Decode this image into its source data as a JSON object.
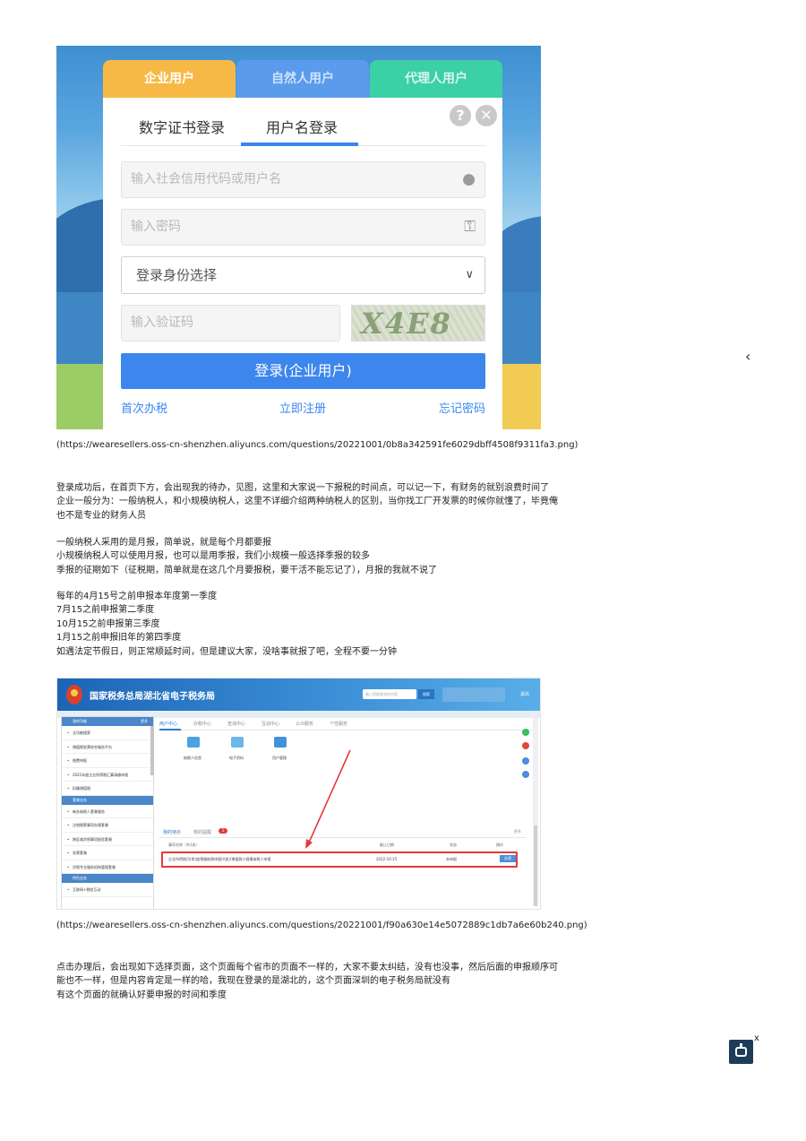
{
  "login": {
    "user_tabs": [
      "企业用户",
      "自然人用户",
      "代理人用户"
    ],
    "method_tabs": [
      "数字证书登录",
      "用户名登录"
    ],
    "help_icon": "?",
    "close_icon": "✕",
    "username_placeholder": "输入社会信用代码或用户名",
    "password_placeholder": "输入密码",
    "role_select": "登录身份选择",
    "captcha_placeholder": "输入验证码",
    "captcha_text": "X4E8",
    "login_button": "登录(企业用户)",
    "links": [
      "首次办税",
      "立即注册",
      "忘记密码"
    ]
  },
  "url1": "(https://weareseIlers.oss-cn-shenzhen.aliyuncs.com/questions/20221001/0b8a342591fe6029dbff4508f9311fa3.png)",
  "para1": [
    "登录成功后，在首页下方，会出现我的待办，见图，这里和大家说一下报税的时间点，可以记一下，有财务的就别浪费时间了",
    "企业一般分为：一般纳税人，和小规模纳税人，这里不详细介绍两种纳税人的区别，当你找工厂开发票的时候你就懂了，毕竟俺",
    "也不是专业的财务人员"
  ],
  "para2": [
    "一般纳税人采用的是月报，简单说，就是每个月都要报",
    "小规模纳税人可以使用月报，也可以是用季报，我们小规模一般选择季报的较多",
    "季报的征期如下（征税期，简单就是在这几个月要报税，要干活不能忘记了），月报的我就不说了"
  ],
  "para3": [
    "每年的4月15号之前申报本年度第一季度",
    "7月15之前申报第二季度",
    "10月15之前申报第三季度",
    "1月15之前申报旧年的第四季度",
    "如遇法定节假日，则正常顺延时间，但是建议大家，没啥事就报了吧，全程不要一分钟"
  ],
  "portal": {
    "title": "国家税务总局湖北省电子税务局",
    "search_placeholder": "输入您要查询的内容",
    "search_button": "搜索",
    "exit": "退出",
    "sidebar_sections": [
      {
        "title": "我的功能",
        "more": "更多",
        "items": [
          "全功能搜索",
          "增值税发票综合服务平台",
          "税费申报",
          "2021年度企业所得税汇算清缴申报",
          "扣缴增值税"
        ]
      },
      {
        "title": "套餐业务",
        "items": [
          "新办纳税人套餐服务",
          "注销税票事项办理套餐",
          "跨区域涉税事项报验套餐",
          "发票套餐",
          "涉税专业服务机构管理套餐"
        ]
      },
      {
        "title": "特色业务",
        "items": [
          "互联网+税收互动"
        ]
      }
    ],
    "tabs": [
      "用户中心",
      "办税中心",
      "查询中心",
      "互动中心",
      "公众服务",
      "个性服务"
    ],
    "icons": [
      "纳税人信息",
      "电子资料",
      "用户管理"
    ],
    "todo_tabs": [
      "我的待办",
      "我的提醒"
    ],
    "todo_badge": "1",
    "todo_more": "更多",
    "columns": [
      "事项名称（共1条）",
      "截止日期",
      "状态",
      "操作"
    ],
    "row": {
      "name": "企业所得税月(季)度预缴纳税申报(A类)/增值税小规模纳税人申报",
      "date": "2022-10-25",
      "status": "未申报",
      "action": "办理"
    }
  },
  "url2": "(https://weareseIlers.oss-cn-shenzhen.aliyuncs.com/questions/20221001/f90a630e14e5072889c1db7a6e60b240.png)",
  "para4": [
    "点击办理后，会出现如下选择页面，这个页面每个省市的页面不一样的，大家不要太纠结，没有也没事，然后后面的申报顺序可",
    "能也不一样，但是内容肯定是一样的哈，我现在登录的是湖北的，这个页面深圳的电子税务局就没有",
    "有这个页面的就确认好要申报的时间和季度"
  ],
  "widgets": {
    "chevron": "‹",
    "bot_close": "x"
  }
}
